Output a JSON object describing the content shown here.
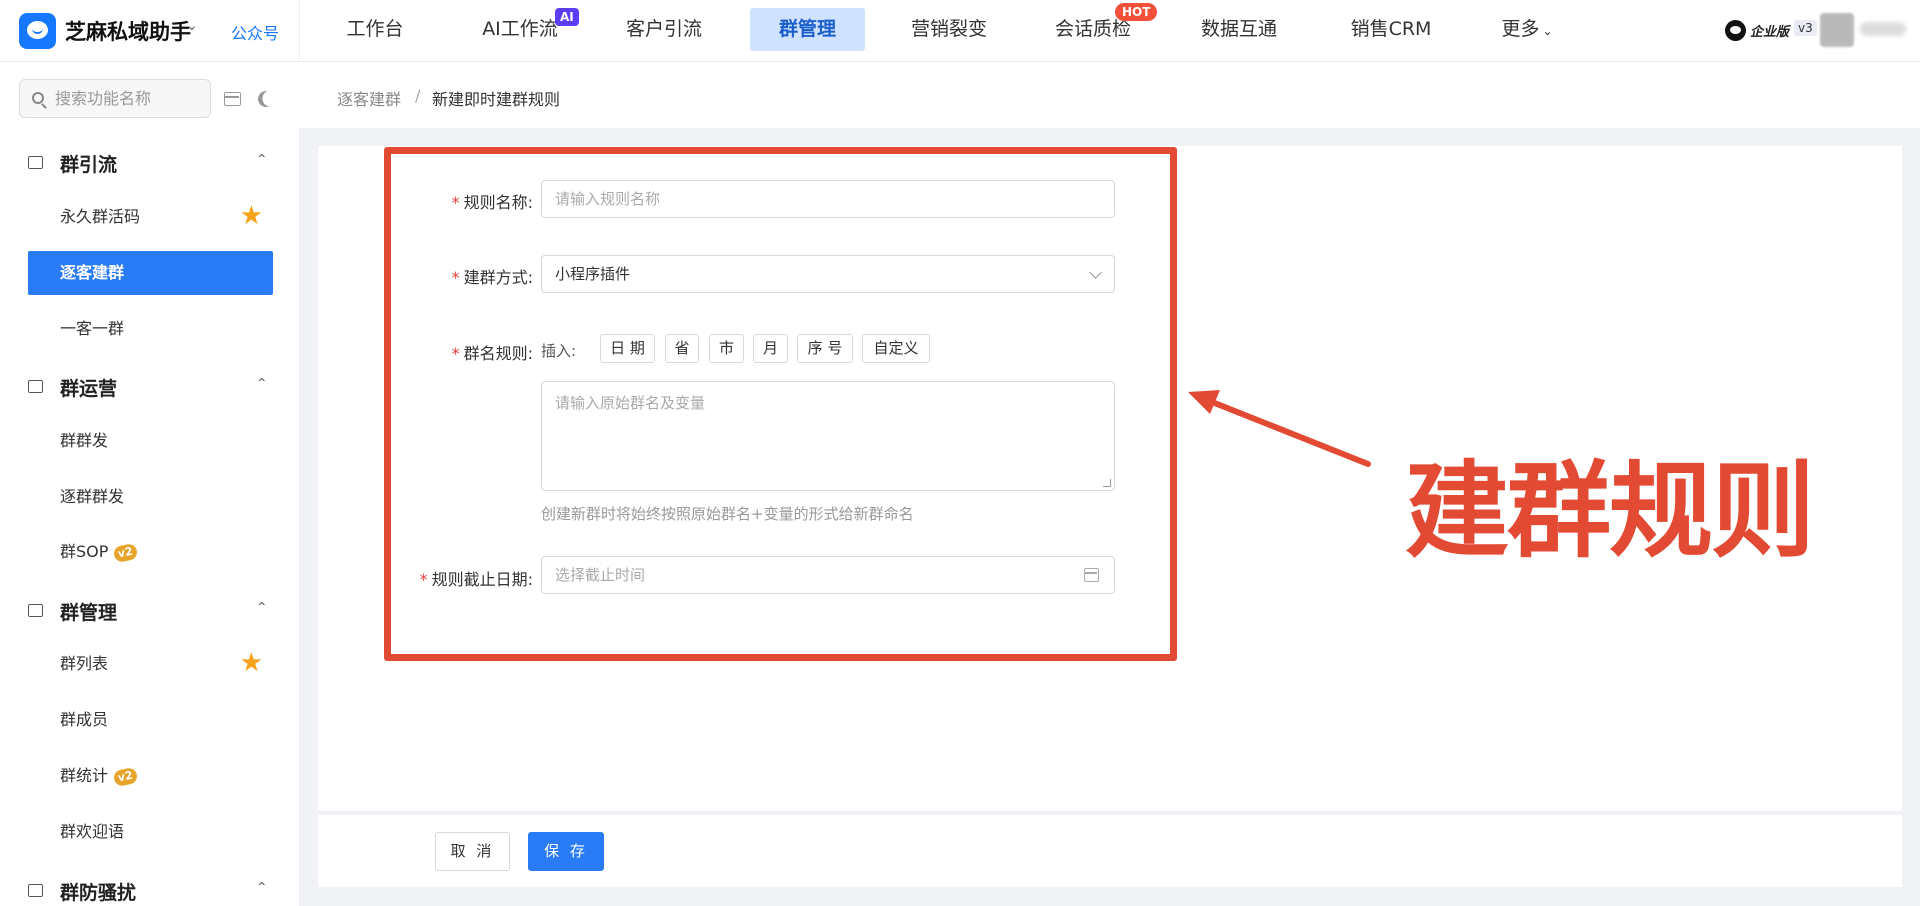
{
  "topbar": {
    "brand": "芝麻私域助手",
    "brand_caret": "⌄",
    "gzh": "公众号",
    "nav": [
      "工作台",
      "AI工作流",
      "客户引流",
      "群管理",
      "营销裂变",
      "会话质检",
      "数据互通",
      "销售CRM",
      "更多"
    ],
    "more_caret": "⌄",
    "ai_tag": "AI",
    "hot_tag": "HOT",
    "ent_label": "企业版",
    "ent_version": "v3"
  },
  "sidebar": {
    "search_placeholder": "搜索功能名称",
    "caret": "⌃",
    "star": "★",
    "groups": [
      {
        "label": "群引流",
        "items": [
          "永久群活码",
          "逐客建群",
          "一客一群"
        ]
      },
      {
        "label": "群运营",
        "items": [
          "群群发",
          "逐群群发",
          "群SOP"
        ]
      },
      {
        "label": "群管理",
        "items": [
          "群列表",
          "群成员",
          "群统计",
          "群欢迎语"
        ]
      },
      {
        "label": "群防骚扰",
        "items": []
      }
    ],
    "badge_v2": "v2"
  },
  "breadcrumb": {
    "parent": "逐客建群",
    "separator": "/",
    "current": "新建即时建群规则"
  },
  "form": {
    "required_mark": "*",
    "rule_name_label": "规则名称:",
    "rule_name_placeholder": "请输入规则名称",
    "method_label": "建群方式:",
    "method_value": "小程序插件",
    "name_rule_label": "群名规则:",
    "insert_label": "插入:",
    "chips": [
      "日 期",
      "省",
      "市",
      "月",
      "序 号",
      "自定义"
    ],
    "textarea_placeholder": "请输入原始群名及变量",
    "hint": "创建新群时将始终按照原始群名+变量的形式给新群命名",
    "end_date_label": "规则截止日期:",
    "end_date_placeholder": "选择截止时间"
  },
  "annotation": {
    "text": "建群规则",
    "color": "#e34a33"
  },
  "footer": {
    "cancel": "取 消",
    "save": "保 存"
  },
  "colors": {
    "accent": "#2a7cf6",
    "nav_active_bg": "#cfe2ff",
    "star": "#f7a21b",
    "annotation": "#e34a33"
  }
}
